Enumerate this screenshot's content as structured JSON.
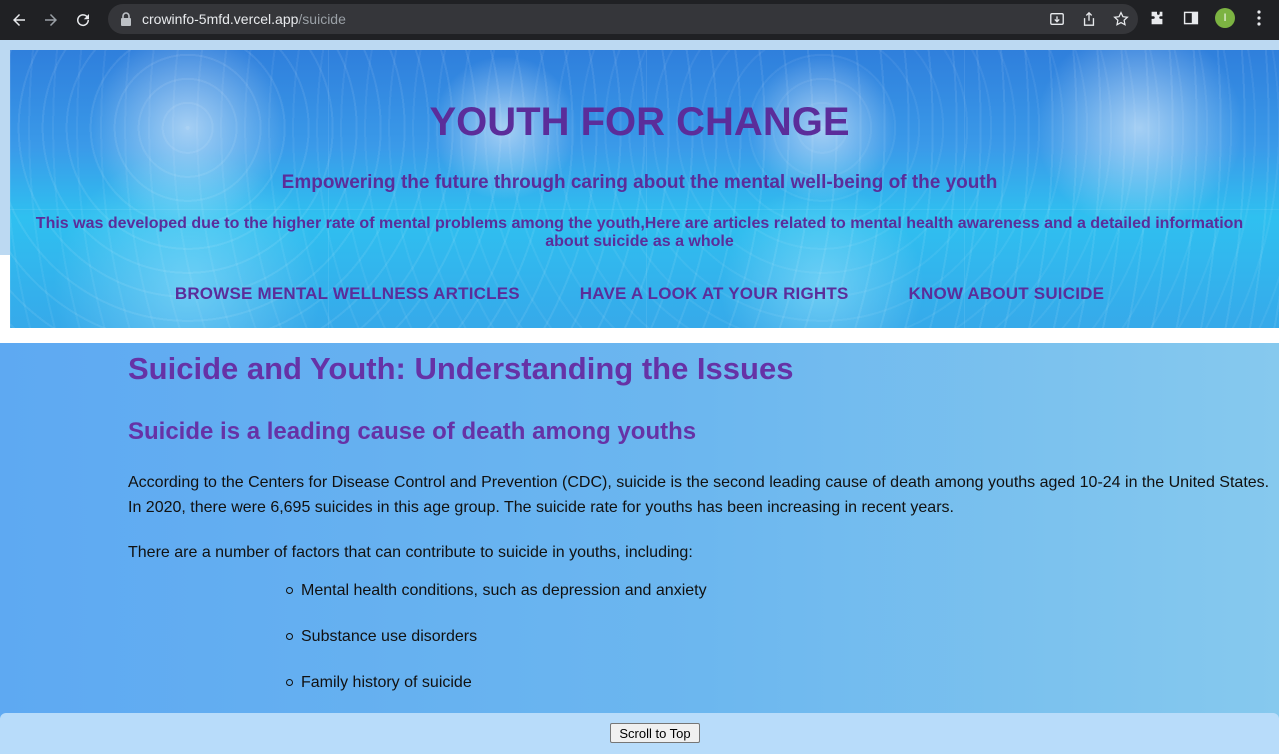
{
  "browser": {
    "url_domain": "crowinfo-5mfd.vercel.app",
    "url_path": "/suicide",
    "profile_initial": "I",
    "icons": [
      "back-icon",
      "forward-icon",
      "reload-icon",
      "lock-icon",
      "download-icon",
      "share-icon",
      "star-icon",
      "extensions-icon",
      "sidepanel-icon",
      "menu-icon"
    ]
  },
  "hero": {
    "title": "YOUTH FOR CHANGE",
    "subtitle": "Empowering the future through caring about the mental well-being of the youth",
    "description": "This was developed due to the higher rate of mental problems among the youth,Here are articles related to mental health awareness and a detailed information about suicide as a whole",
    "nav": [
      {
        "label": "BROWSE MENTAL WELLNESS ARTICLES"
      },
      {
        "label": "HAVE A LOOK AT YOUR RIGHTS"
      },
      {
        "label": "KNOW ABOUT SUICIDE"
      }
    ]
  },
  "article": {
    "title": "Suicide and Youth: Understanding the Issues",
    "section_title": "Suicide is a leading cause of death among youths",
    "paragraph1": "According to the Centers for Disease Control and Prevention (CDC), suicide is the second leading cause of death among youths aged 10-24 in the United States. In 2020, there were 6,695 suicides in this age group. The suicide rate for youths has been increasing in recent years.",
    "paragraph2": "There are a number of factors that can contribute to suicide in youths, including:",
    "factors": [
      "Mental health conditions, such as depression and anxiety",
      "Substance use disorders",
      "Family history of suicide"
    ]
  },
  "footer": {
    "scroll_button": "Scroll to Top"
  },
  "colors": {
    "accent_purple": "#6632a6",
    "chrome_bg": "#202124"
  }
}
